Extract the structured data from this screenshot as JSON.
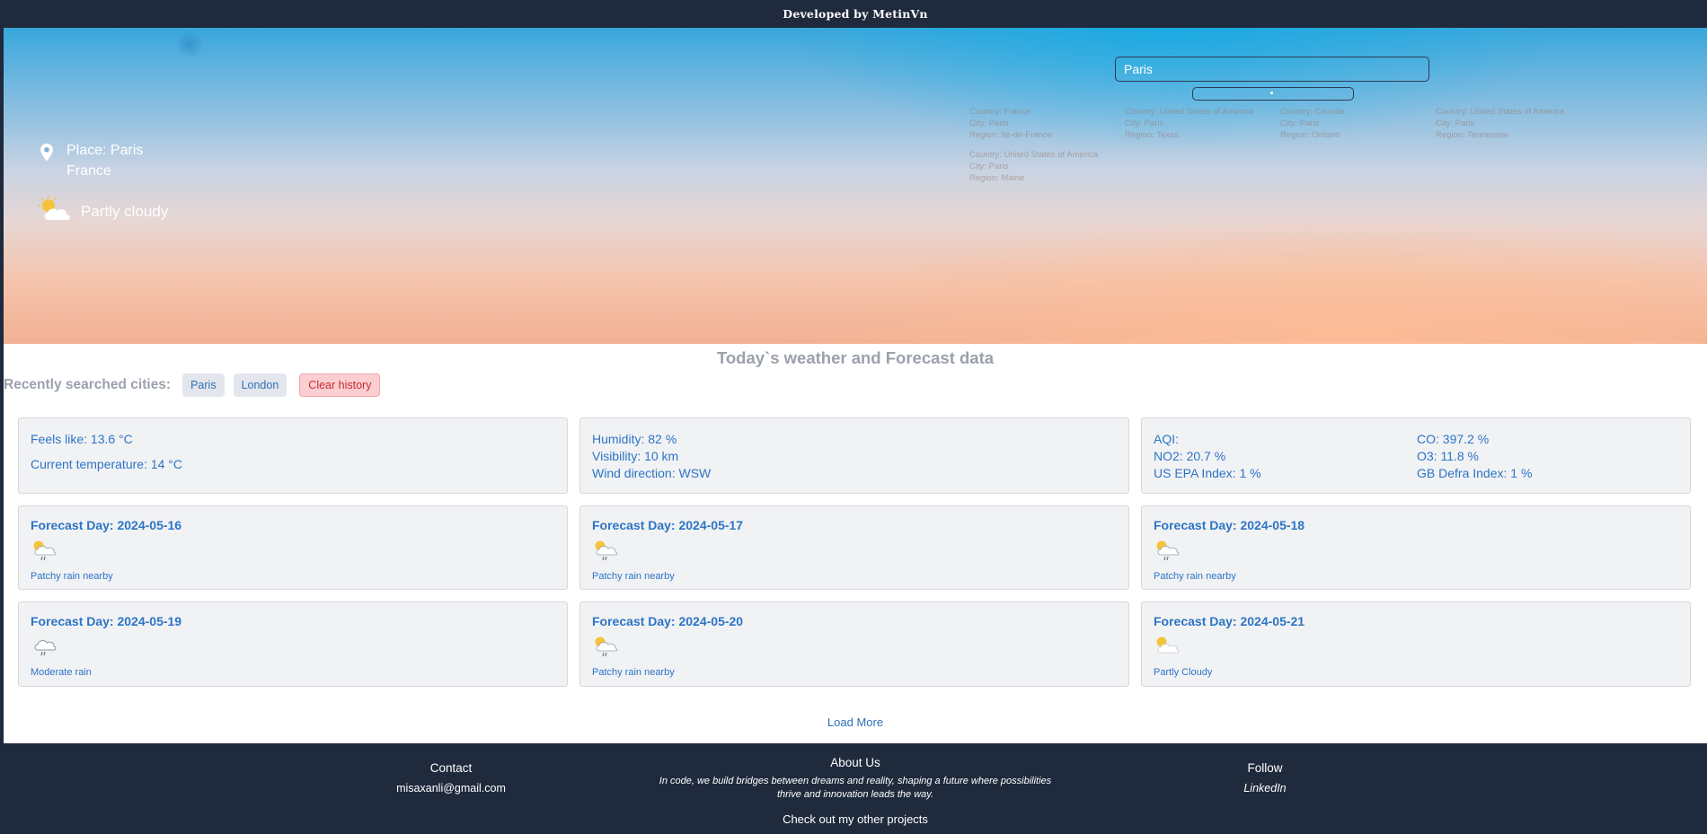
{
  "header": {
    "credit": "Developed by MetinVn"
  },
  "hero": {
    "place_line": "Place: Paris",
    "country_line": "France",
    "condition": "Partly cloudy"
  },
  "search": {
    "value": "Paris",
    "suggestions": [
      {
        "country": "Country: France",
        "city": "City: Paris",
        "region": "Region: Ile-de-France"
      },
      {
        "country": "Country: United States of America",
        "city": "City: Paris",
        "region": "Region: Texas"
      },
      {
        "country": "Country: Canada",
        "city": "City: Paris",
        "region": "Region: Ontario"
      },
      {
        "country": "Country: United States of America",
        "city": "City: Paris",
        "region": "Region: Tennessee"
      },
      {
        "country": "Country: United States of America",
        "city": "City: Paris",
        "region": "Region: Maine"
      }
    ]
  },
  "main": {
    "title": "Today`s weather and Forecast data",
    "recent_label": "Recently searched cities:",
    "recent_cities": [
      "Paris",
      "London"
    ],
    "clear_label": "Clear history"
  },
  "current": {
    "feels_like": "Feels like: 13.6 °C",
    "current_temp": "Current temperature: 14 °C",
    "humidity": "Humidity: 82 %",
    "visibility": "Visibility: 10 km",
    "wind_direction": "Wind direction: WSW",
    "aqi": "AQI:",
    "co": "CO: 397.2 %",
    "no2": "NO2: 20.7 %",
    "o3": "O3: 11.8 %",
    "us_epa": "US EPA Index: 1 %",
    "gb_defra": "GB Defra Index: 1 %"
  },
  "forecast": [
    {
      "title": "Forecast Day: 2024-05-16",
      "desc": "Patchy rain nearby",
      "icon": "patchy-rain-icon"
    },
    {
      "title": "Forecast Day: 2024-05-17",
      "desc": "Patchy rain nearby",
      "icon": "patchy-rain-icon"
    },
    {
      "title": "Forecast Day: 2024-05-18",
      "desc": "Patchy rain nearby",
      "icon": "patchy-rain-icon"
    },
    {
      "title": "Forecast Day: 2024-05-19",
      "desc": "Moderate rain",
      "icon": "moderate-rain-icon"
    },
    {
      "title": "Forecast Day: 2024-05-20",
      "desc": "Patchy rain nearby",
      "icon": "patchy-rain-icon"
    },
    {
      "title": "Forecast Day: 2024-05-21",
      "desc": "Partly Cloudy",
      "icon": "partly-cloudy-icon"
    }
  ],
  "load_more": "Load More",
  "footer": {
    "contact_heading": "Contact",
    "contact_email": "misaxanli@gmail.com",
    "about_heading": "About Us",
    "about_line1": "In code, we build bridges between dreams and reality, shaping a future where possibilities",
    "about_line2": "thrive and innovation leads the way.",
    "other_projects": "Check out my other projects",
    "follow_heading": "Follow",
    "follow_link": "LinkedIn"
  },
  "colors": {
    "navy": "#1f2a3d",
    "accent_blue": "#2c74c6",
    "card_bg": "#f1f2f4",
    "clear_bg": "#fbcfd1"
  }
}
